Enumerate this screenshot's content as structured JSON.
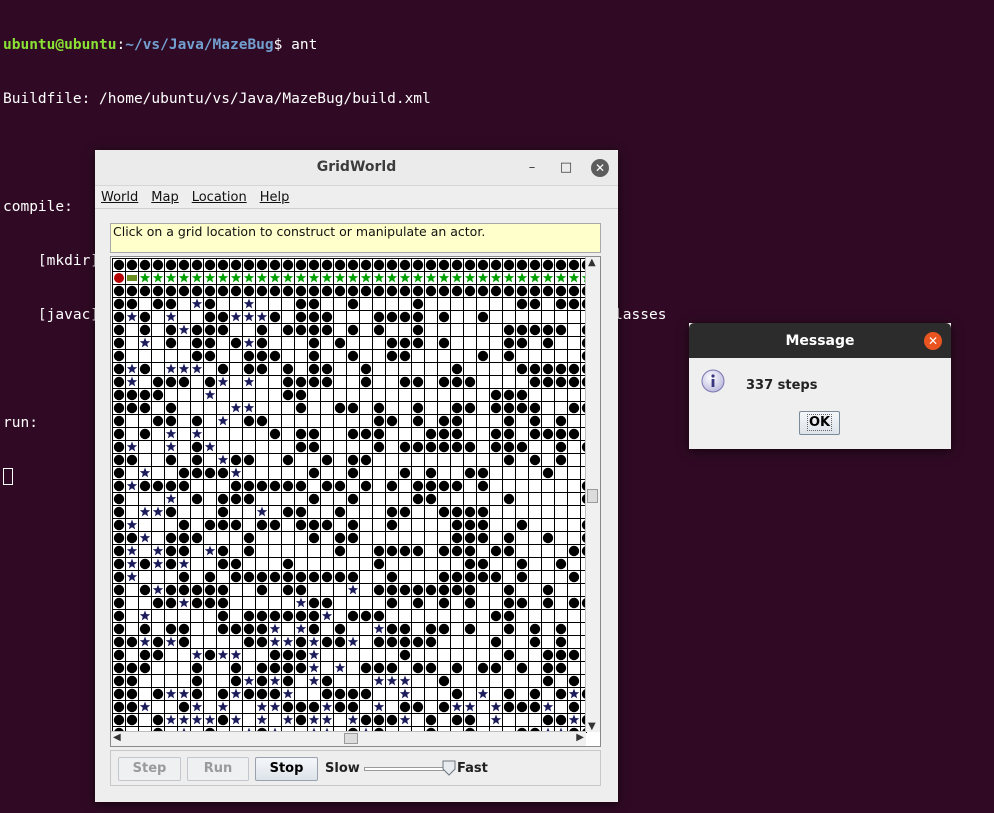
{
  "terminal": {
    "prompt_user": "ubuntu@ubuntu",
    "prompt_sep": ":",
    "prompt_path": "~/vs/Java/MazeBug",
    "prompt_end": "$ ",
    "command": "ant",
    "lines": [
      "Buildfile: /home/ubuntu/vs/Java/MazeBug/build.xml",
      "",
      "compile:",
      "    [mkdir] Created dir: /home/ubuntu/vs/Java/MazeBug/classes",
      "    [javac] Compiling 2 source files to /home/ubuntu/vs/Java/MazeBug/classes",
      "",
      "run:"
    ]
  },
  "gridworld": {
    "title": "GridWorld",
    "menus": [
      "World",
      "Map",
      "Location",
      "Help"
    ],
    "message": "Click on a grid location to construct or manipulate an actor.",
    "buttons": {
      "step": "Step",
      "run": "Run",
      "stop": "Stop"
    },
    "speed": {
      "slow": "Slow",
      "fast": "Fast",
      "level": 0.95
    },
    "colors": {
      "wall": "#000000",
      "visited_path": "#1c1c5a",
      "bug": "#b40000",
      "current_path": "#00a000"
    }
  },
  "dialog": {
    "title": "Message",
    "message": "337 steps",
    "ok": "OK",
    "icon": "info-icon"
  }
}
